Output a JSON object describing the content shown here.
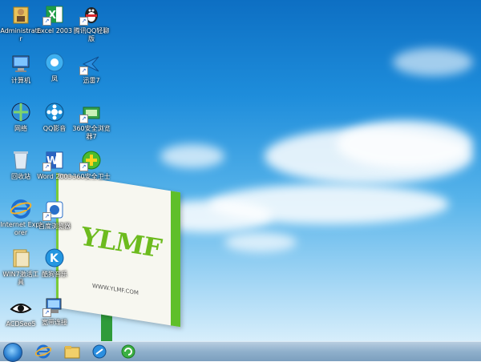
{
  "desktop": {
    "icons": [
      {
        "label": "Administrator",
        "icon": "user-folder-icon"
      },
      {
        "label": "Excel 2003",
        "icon": "excel-icon"
      },
      {
        "label": "腾讯QQ轻聊版",
        "icon": "qq-penguin-icon"
      },
      {
        "label": "计算机",
        "icon": "computer-icon"
      },
      {
        "label": "凤",
        "icon": "qq-browser-icon"
      },
      {
        "label": "迅雷7",
        "icon": "thunder-icon"
      },
      {
        "label": "网络",
        "icon": "network-icon"
      },
      {
        "label": "QQ影音",
        "icon": "qq-player-icon"
      },
      {
        "label": "360安全浏览器7",
        "icon": "browser-360-icon"
      },
      {
        "label": "回收站",
        "icon": "recycle-bin-icon"
      },
      {
        "label": "Word 2003",
        "icon": "word-icon"
      },
      {
        "label": "360安全卫士",
        "icon": "safeguard-360-icon"
      },
      {
        "label": "Internet Explorer",
        "icon": "internet-explorer-icon"
      },
      {
        "label": "百度浏览器",
        "icon": "baidu-browser-icon"
      },
      {
        "label": "WIN7激活工具",
        "icon": "activation-folder-icon"
      },
      {
        "label": "酷狗音乐",
        "icon": "kugou-icon"
      },
      {
        "label": "ACDSee5",
        "icon": "acdsee-eye-icon"
      },
      {
        "label": "宽带连接",
        "icon": "broadband-icon"
      }
    ]
  },
  "wallpaper": {
    "brand": "YLMF",
    "url": "WWW.YLMF.COM"
  },
  "taskbar": {
    "items": [
      {
        "icon": "start-orb-icon"
      },
      {
        "icon": "internet-explorer-icon"
      },
      {
        "icon": "file-explorer-icon"
      },
      {
        "icon": "browser-icon"
      },
      {
        "icon": "refresh-browser-icon"
      }
    ]
  },
  "colors": {
    "sky_top": "#0d6fc3",
    "sky_bottom": "#d7eefb",
    "sign_green": "#5fbf2a",
    "taskbar": "#8fb0cc"
  }
}
